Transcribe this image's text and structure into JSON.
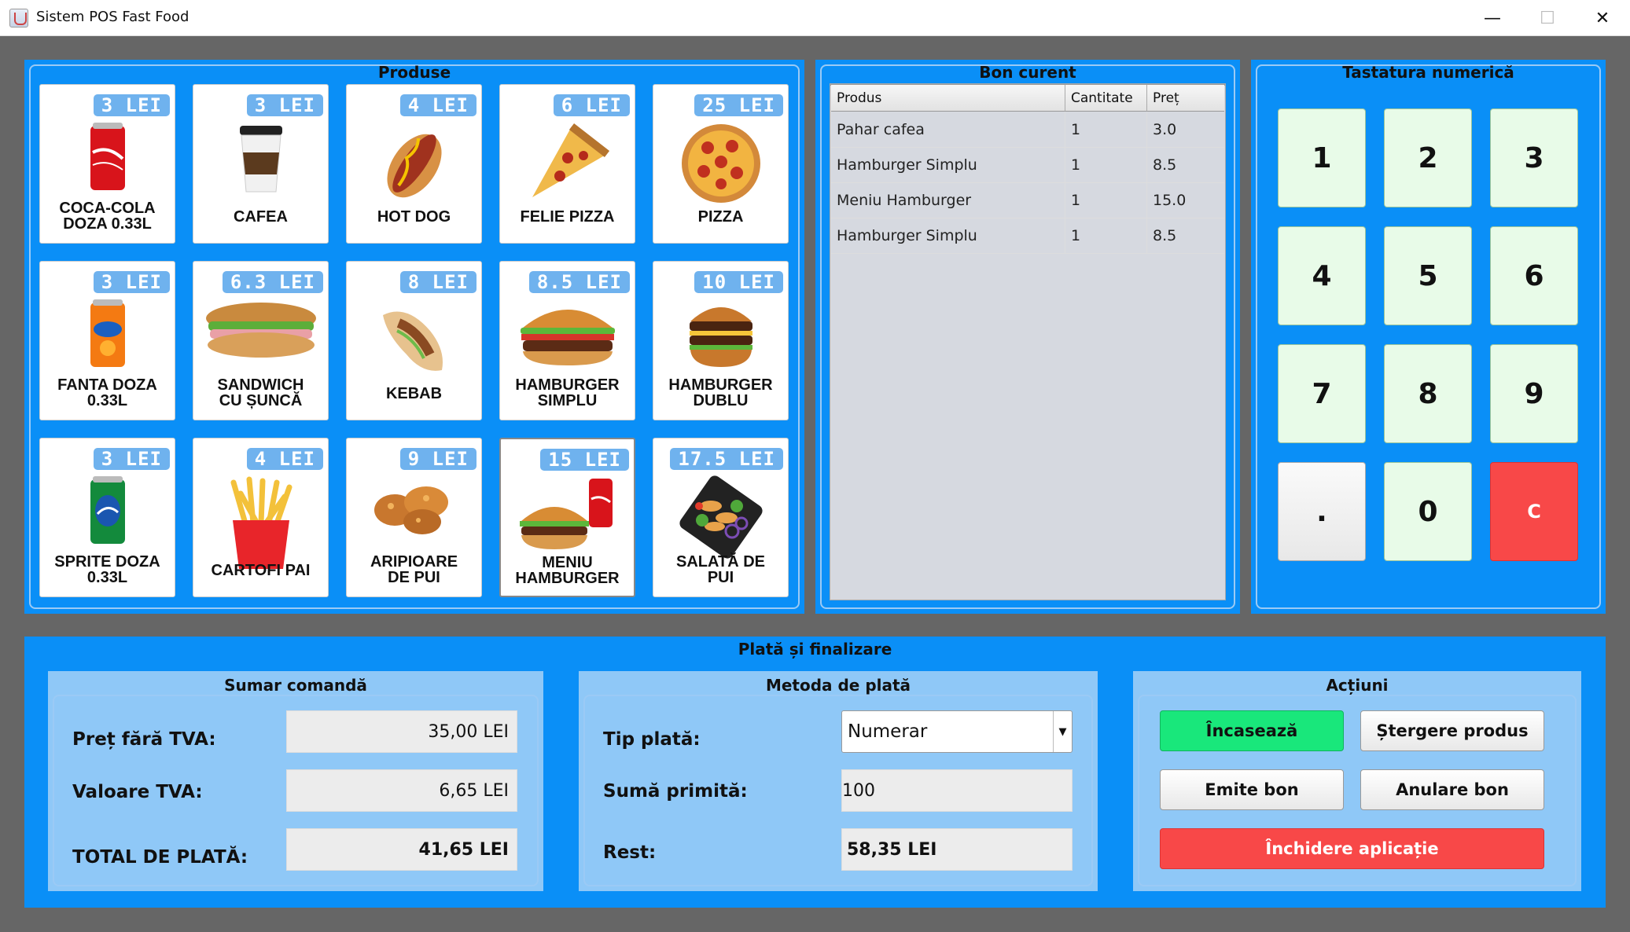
{
  "window": {
    "title": "Sistem POS Fast Food",
    "controls": {
      "minimize": "—",
      "maximize": "☐",
      "close": "✕"
    }
  },
  "products_panel": {
    "title": "Produse",
    "items": [
      {
        "price": "3 LEI",
        "name1": "COCA-COLA",
        "name2": "DOZA 0.33L",
        "icon": "coca-cola-can-icon"
      },
      {
        "price": "3 LEI",
        "name1": "CAFEA",
        "name2": "",
        "icon": "coffee-cup-icon"
      },
      {
        "price": "4 LEI",
        "name1": "HOT DOG",
        "name2": "",
        "icon": "hot-dog-icon"
      },
      {
        "price": "6 LEI",
        "name1": "FELIE PIZZA",
        "name2": "",
        "icon": "pizza-slice-icon"
      },
      {
        "price": "25 LEI",
        "name1": "PIZZA",
        "name2": "",
        "icon": "pizza-icon"
      },
      {
        "price": "3 LEI",
        "name1": "FANTA DOZA",
        "name2": "0.33L",
        "icon": "fanta-can-icon"
      },
      {
        "price": "6.3 LEI",
        "name1": "SANDWICH",
        "name2": "CU ȘUNCĂ",
        "icon": "sandwich-icon"
      },
      {
        "price": "8 LEI",
        "name1": "KEBAB",
        "name2": "",
        "icon": "kebab-icon"
      },
      {
        "price": "8.5 LEI",
        "name1": "HAMBURGER",
        "name2": "SIMPLU",
        "icon": "hamburger-icon"
      },
      {
        "price": "10 LEI",
        "name1": "HAMBURGER",
        "name2": "DUBLU",
        "icon": "double-hamburger-icon"
      },
      {
        "price": "3 LEI",
        "name1": "SPRITE DOZA",
        "name2": "0.33L",
        "icon": "sprite-can-icon"
      },
      {
        "price": "4 LEI",
        "name1": "CARTOFI PAI",
        "name2": "",
        "icon": "french-fries-icon"
      },
      {
        "price": "9 LEI",
        "name1": "ARIPIOARE",
        "name2": "DE PUI",
        "icon": "chicken-wings-icon"
      },
      {
        "price": "15 LEI",
        "name1": "MENIU",
        "name2": "HAMBURGER",
        "icon": "burger-menu-icon"
      },
      {
        "price": "17.5 LEI",
        "name1": "SALATĂ DE",
        "name2": "PUI",
        "icon": "chicken-salad-icon"
      }
    ]
  },
  "receipt_panel": {
    "title": "Bon curent",
    "columns": [
      "Produs",
      "Cantitate",
      "Preț"
    ],
    "rows": [
      [
        "Pahar cafea",
        "1",
        "3.0"
      ],
      [
        "Hamburger Simplu",
        "1",
        "8.5"
      ],
      [
        "Meniu Hamburger",
        "1",
        "15.0"
      ],
      [
        "Hamburger Simplu",
        "1",
        "8.5"
      ]
    ]
  },
  "numpad_panel": {
    "title": "Tastatura numerică",
    "keys": [
      "1",
      "2",
      "3",
      "4",
      "5",
      "6",
      "7",
      "8",
      "9",
      ".",
      "0",
      "C"
    ]
  },
  "payment_panel": {
    "title": "Plată și finalizare",
    "summary": {
      "title": "Sumar comandă",
      "pret_fara_tva_label": "Preț fără TVA:",
      "pret_fara_tva_value": "35,00 LEI",
      "valoare_tva_label": "Valoare TVA:",
      "valoare_tva_value": "6,65 LEI",
      "total_label": "TOTAL DE PLATĂ:",
      "total_value": "41,65 LEI"
    },
    "method": {
      "title": "Metoda de plată",
      "tip_plata_label": "Tip plată:",
      "tip_plata_value": "Numerar",
      "suma_primita_label": "Sumă primită:",
      "suma_primita_value": "100",
      "rest_label": "Rest:",
      "rest_value": "58,35 LEI"
    },
    "actions": {
      "title": "Acțiuni",
      "incaseaza": "Încasează",
      "stergere": "Ștergere produs",
      "emite": "Emite bon",
      "anulare": "Anulare bon",
      "inchidere": "Închidere aplicație"
    }
  },
  "colors": {
    "panel_blue": "#0a8ff7",
    "sub_panel_blue": "#8fc8f7",
    "key_green": "#e8fbe8",
    "accent_green": "#19e77b",
    "accent_red": "#f84848"
  }
}
